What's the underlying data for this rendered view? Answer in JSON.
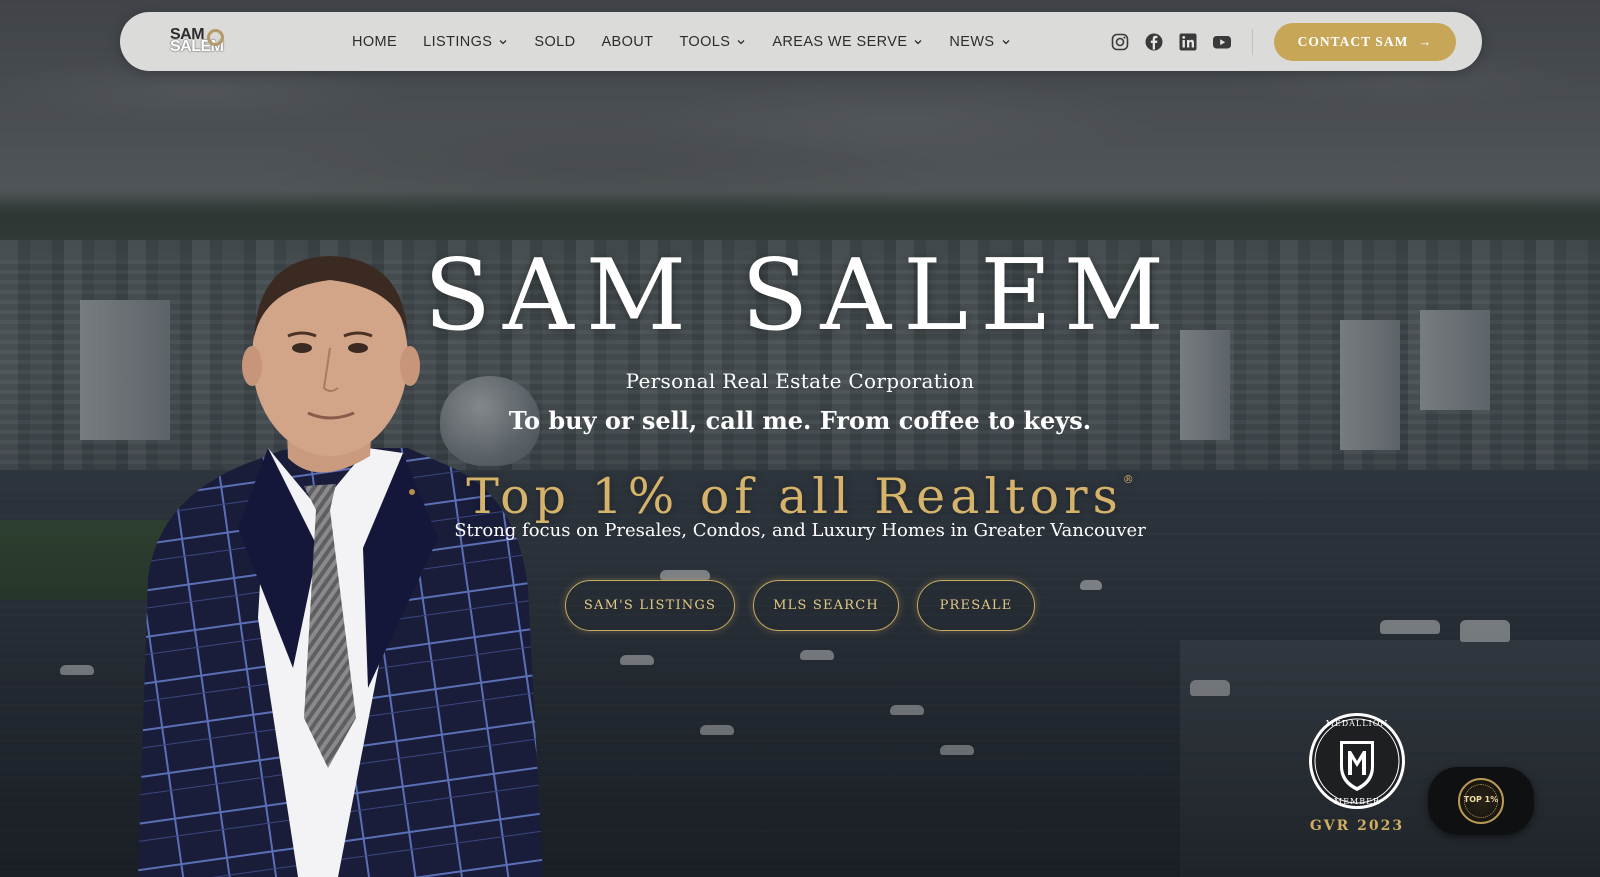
{
  "header": {
    "logo": {
      "line1": "SAM",
      "line2": "SALEM"
    },
    "nav": [
      {
        "label": "HOME",
        "dropdown": false
      },
      {
        "label": "LISTINGS",
        "dropdown": true
      },
      {
        "label": "SOLD",
        "dropdown": false
      },
      {
        "label": "ABOUT",
        "dropdown": false
      },
      {
        "label": "TOOLS",
        "dropdown": true
      },
      {
        "label": "AREAS WE SERVE",
        "dropdown": true
      },
      {
        "label": "NEWS",
        "dropdown": true
      }
    ],
    "social_icons": [
      "instagram-icon",
      "facebook-icon",
      "linkedin-icon",
      "youtube-icon"
    ],
    "contact_button": "CONTACT SAM",
    "contact_arrow": "→"
  },
  "hero": {
    "name": "SAM SALEM",
    "corporation": "Personal Real Estate Corporation",
    "tagline": "To buy or sell, call me. From coffee to keys.",
    "highlight": "Top 1% of all Realtors",
    "highlight_mark": "®",
    "focus": "Strong focus on Presales, Condos, and Luxury Homes in Greater Vancouver",
    "buttons": [
      "SAM'S LISTINGS",
      "MLS SEARCH",
      "PRESALE"
    ]
  },
  "badges": {
    "medallion_text": "MLS MEDALLION CLUB MEMBER",
    "medallion_letter": "M",
    "medallion_caption": "GVR 2023",
    "top_badge": "TOP 1%"
  },
  "colors": {
    "gold": "#c7a657",
    "gold_text": "#d6b36a",
    "nav_bg": "#e4e4e2",
    "nav_text": "#2d2d2d"
  }
}
